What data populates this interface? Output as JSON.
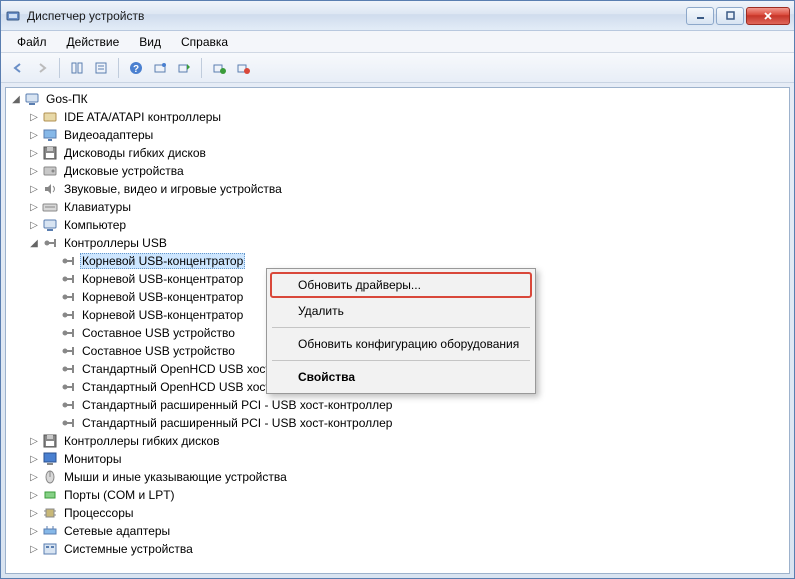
{
  "window": {
    "title": "Диспетчер устройств"
  },
  "menubar": {
    "file": "Файл",
    "action": "Действие",
    "view": "Вид",
    "help": "Справка"
  },
  "tree": {
    "root": "Gos-ПК",
    "categories": [
      {
        "label": "IDE ATA/ATAPI контроллеры",
        "expanded": false
      },
      {
        "label": "Видеоадаптеры",
        "expanded": false
      },
      {
        "label": "Дисководы гибких дисков",
        "expanded": false
      },
      {
        "label": "Дисковые устройства",
        "expanded": false
      },
      {
        "label": "Звуковые, видео и игровые устройства",
        "expanded": false
      },
      {
        "label": "Клавиатуры",
        "expanded": false
      },
      {
        "label": "Компьютер",
        "expanded": false
      },
      {
        "label": "Контроллеры USB",
        "expanded": true,
        "children": [
          "Корневой USB-концентратор",
          "Корневой USB-концентратор",
          "Корневой USB-концентратор",
          "Корневой USB-концентратор",
          "Составное USB устройство",
          "Составное USB устройство",
          "Стандартный OpenHCD USB хост-контроллер",
          "Стандартный OpenHCD USB хост-контроллер",
          "Стандартный расширенный PCI - USB хост-контроллер",
          "Стандартный расширенный PCI - USB хост-контроллер"
        ]
      },
      {
        "label": "Контроллеры гибких дисков",
        "expanded": false
      },
      {
        "label": "Мониторы",
        "expanded": false
      },
      {
        "label": "Мыши и иные указывающие устройства",
        "expanded": false
      },
      {
        "label": "Порты (COM и LPT)",
        "expanded": false
      },
      {
        "label": "Процессоры",
        "expanded": false
      },
      {
        "label": "Сетевые адаптеры",
        "expanded": false
      },
      {
        "label": "Системные устройства",
        "expanded": false
      }
    ]
  },
  "context_menu": {
    "update_drivers": "Обновить драйверы...",
    "delete": "Удалить",
    "scan_hardware": "Обновить конфигурацию оборудования",
    "properties": "Свойства"
  }
}
